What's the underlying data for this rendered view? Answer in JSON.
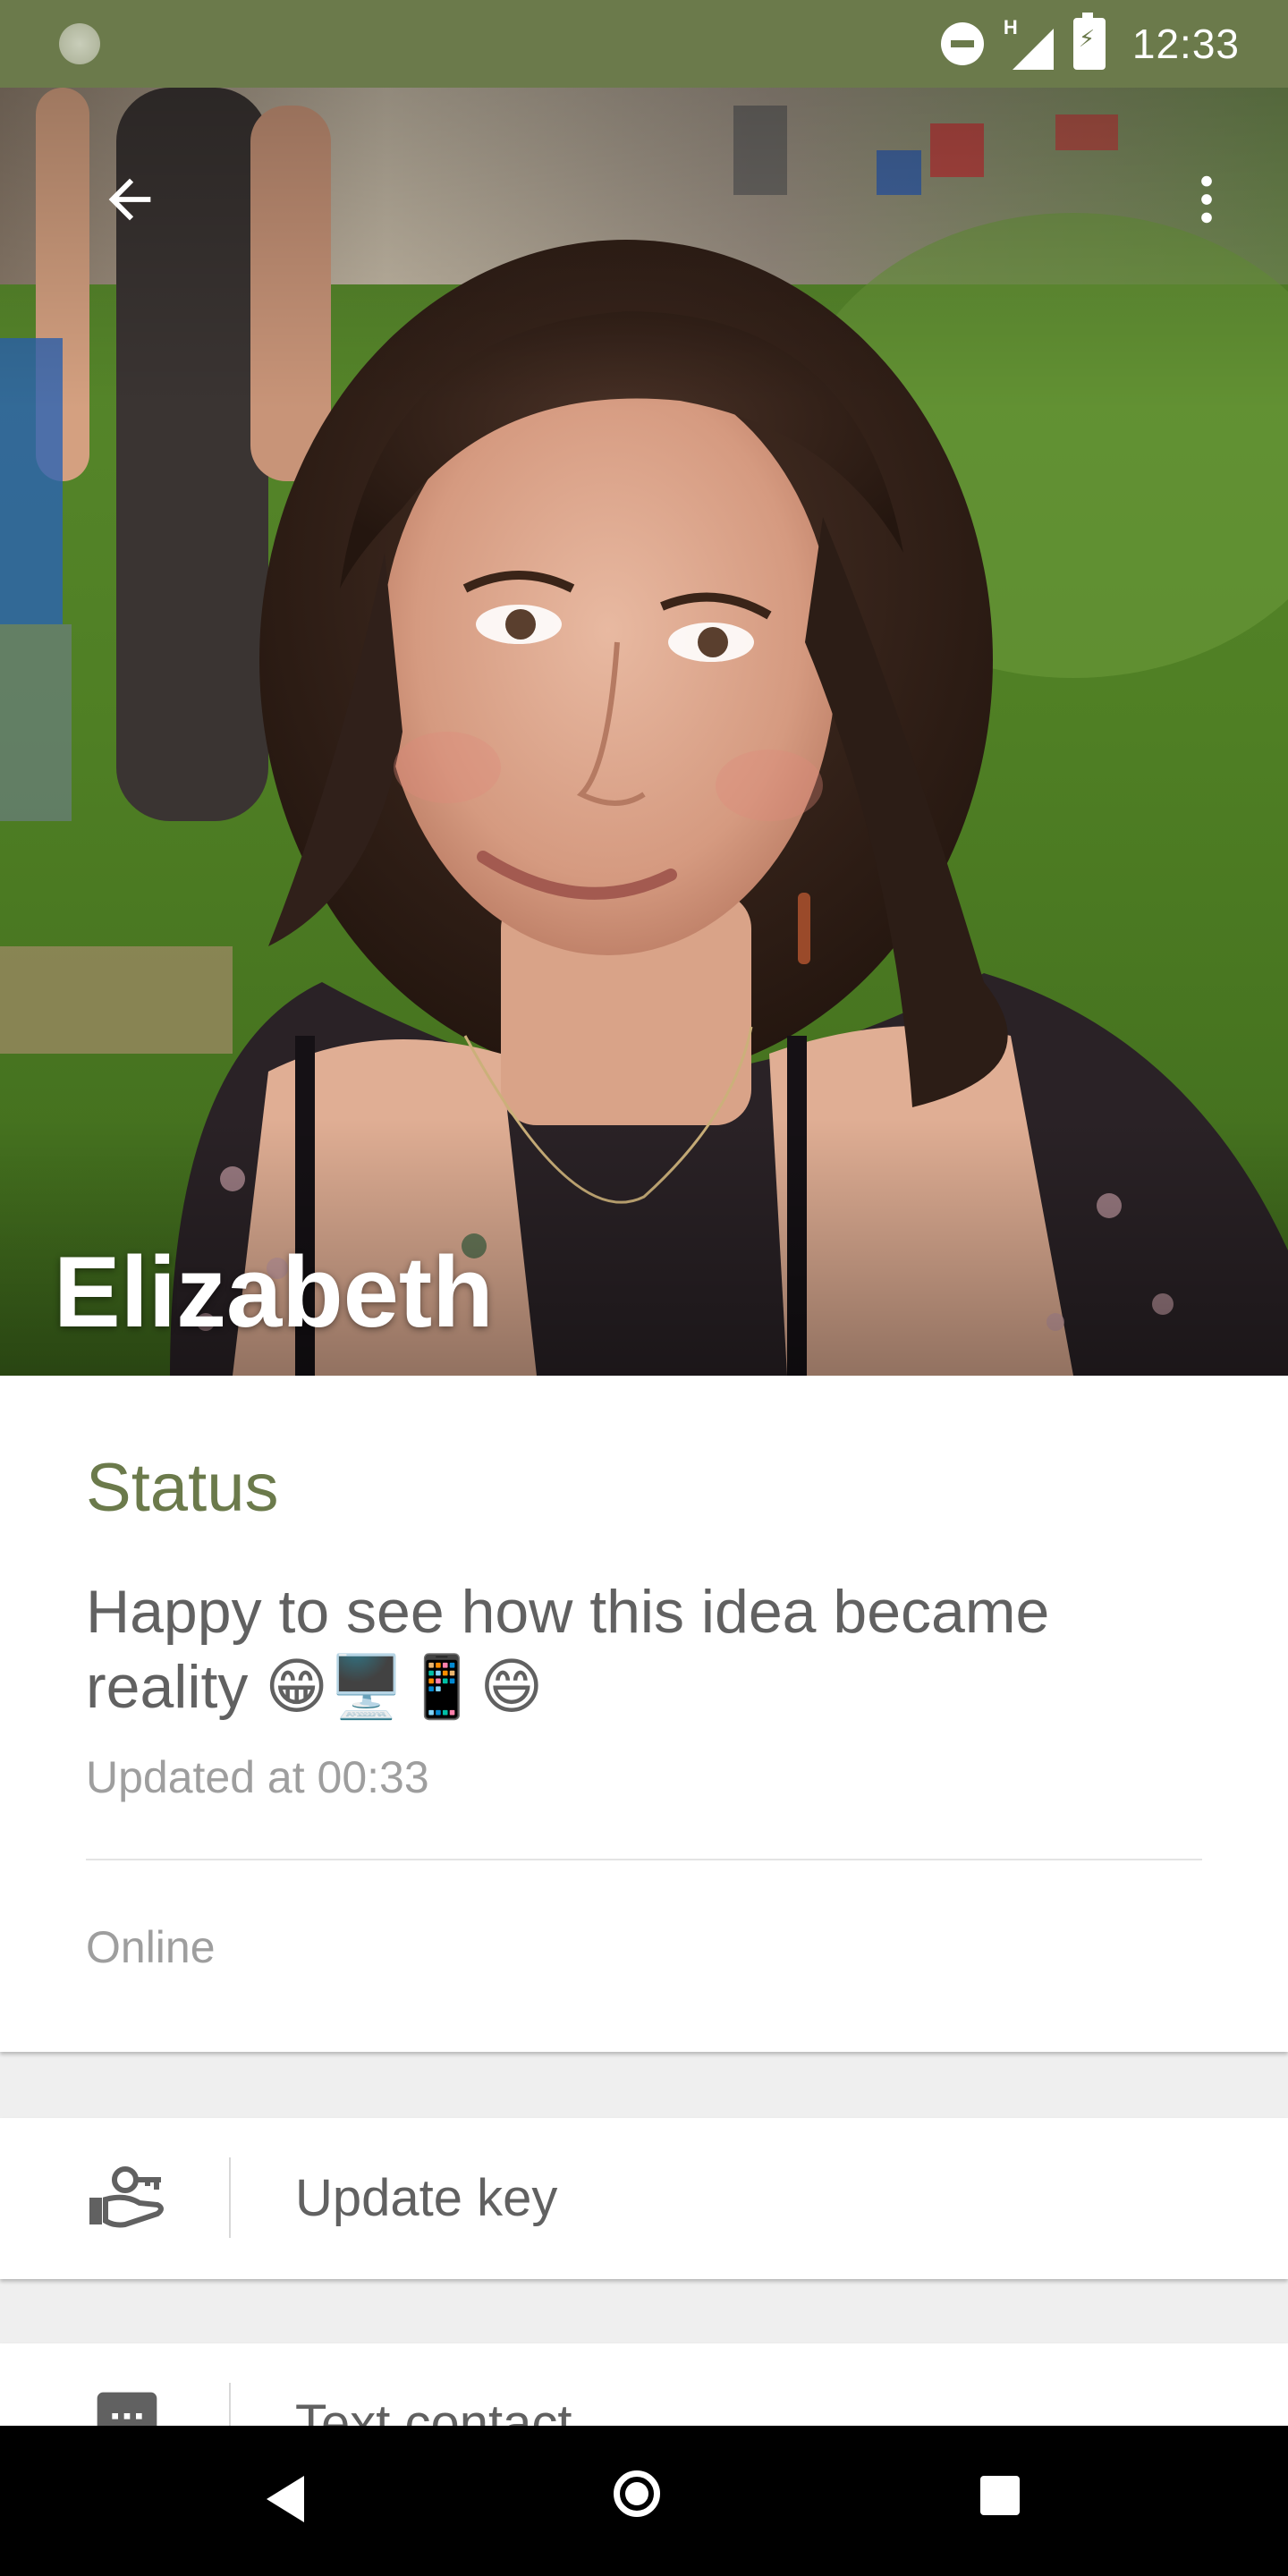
{
  "status_bar": {
    "time": "12:33",
    "network_type": "H",
    "icons": [
      "loading-icon",
      "do-not-disturb-icon",
      "signal-icon",
      "battery-charging-icon"
    ]
  },
  "header": {
    "name": "Elizabeth",
    "back_icon": "arrow-back-icon",
    "menu_icon": "more-vert-icon",
    "photo": "profile-photo"
  },
  "status_section": {
    "title": "Status",
    "text": "Happy to see how this idea became reality 😁🖥️📱😄",
    "updated": "Updated at 00:33",
    "presence": "Online"
  },
  "actions": [
    {
      "label": "Update key",
      "icon": "key-in-hand-icon"
    },
    {
      "label": "Text contact",
      "icon": "message-icon"
    }
  ],
  "colors": {
    "accent": "#6b7a4b",
    "text_primary": "#616161",
    "text_secondary": "#9e9e9e",
    "background": "#efefef",
    "nav_bar": "#000000"
  }
}
